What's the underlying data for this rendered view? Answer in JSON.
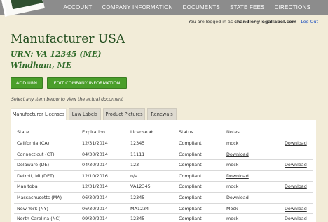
{
  "nav": [
    "ACCOUNT",
    "COMPANY INFORMATION",
    "DOCUMENTS",
    "STATE FEES",
    "DIRECTIONS"
  ],
  "login": {
    "prefix": "You are logged in as",
    "user": "chandler@legallabel.com",
    "sep": "|",
    "logout": "Log Out"
  },
  "company": {
    "name": "Manufacturer USA",
    "urn": "URN: VA 12345 (ME)",
    "location": "Windham, ME"
  },
  "buttons": {
    "add_urn": "ADD URN",
    "edit_company": "EDIT COMPANY INFORMATION"
  },
  "hint": "Select any item below to view the actual document",
  "tabs": [
    "Manufacturer Licenses",
    "Law Labels",
    "Product Pictures",
    "Renewals"
  ],
  "table": {
    "headers": [
      "State",
      "Expiration",
      "License #",
      "Status",
      "Notes"
    ],
    "rows": [
      {
        "state": "California (CA)",
        "expiration": "12/31/2014",
        "license": "12345",
        "status": "Compliant",
        "notes": "mock",
        "notes_link": false,
        "download": "Download"
      },
      {
        "state": "Connecticut (CT)",
        "expiration": "04/30/2014",
        "license": "11111",
        "status": "Compliant",
        "notes": "Download",
        "notes_link": true,
        "download": ""
      },
      {
        "state": "Delaware (DE)",
        "expiration": "04/30/2014",
        "license": "123",
        "status": "Compliant",
        "notes": "mock",
        "notes_link": false,
        "download": "Download"
      },
      {
        "state": "Detroit, MI (DET)",
        "expiration": "12/10/2016",
        "license": "n/a",
        "status": "Compliant",
        "notes": "Download",
        "notes_link": true,
        "download": ""
      },
      {
        "state": "Manitoba",
        "expiration": "12/31/2014",
        "license": "VA12345",
        "status": "Compliant",
        "notes": "mock",
        "notes_link": false,
        "download": "Download"
      },
      {
        "state": "Massachusetts (MA)",
        "expiration": "06/30/2014",
        "license": "12345",
        "status": "Compliant",
        "notes": "Download",
        "notes_link": true,
        "download": ""
      },
      {
        "state": "New York (NY)",
        "expiration": "06/30/2014",
        "license": "MA1234",
        "status": "Compliant",
        "notes": "Mock",
        "notes_link": false,
        "download": "Download"
      },
      {
        "state": "North Carolina (NC)",
        "expiration": "09/30/2014",
        "license": "12345",
        "status": "Compliant",
        "notes": "mock",
        "notes_link": false,
        "download": "Download"
      }
    ]
  },
  "colors": {
    "background": "#f2ecd8",
    "topbar": "#8c8c8c",
    "button": "#4a9e2a",
    "title": "#234e1f"
  }
}
